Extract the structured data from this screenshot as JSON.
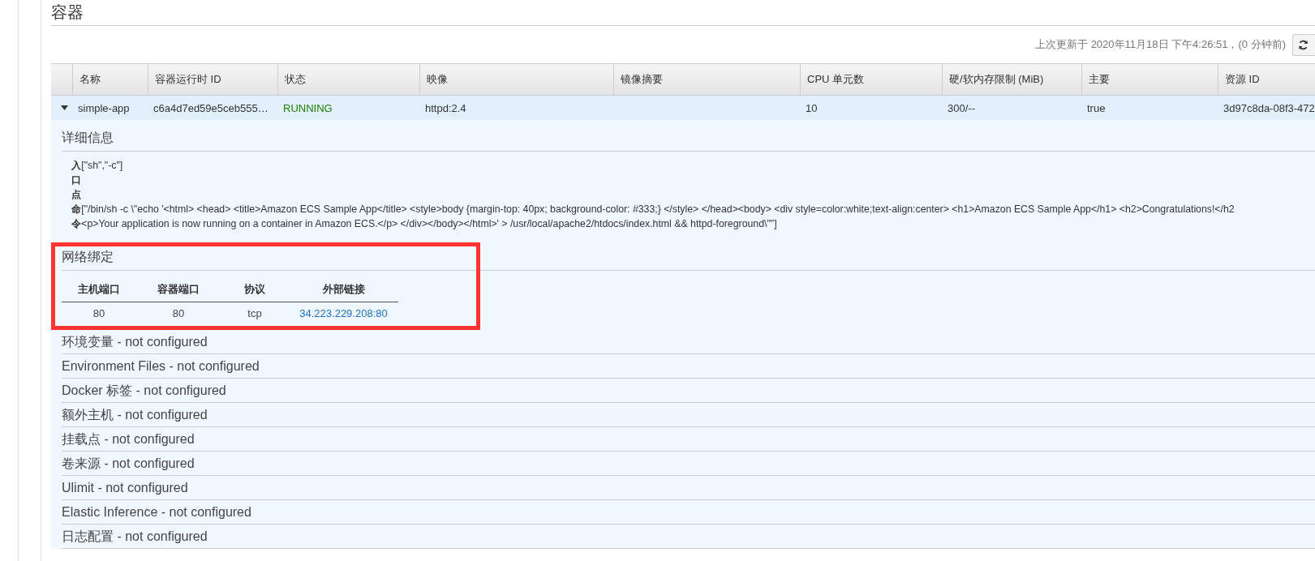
{
  "title": "容器",
  "last_updated": "上次更新于 2020年11月18日 下午4:26:51，(0 分钟前)",
  "table": {
    "columns": [
      "名称",
      "容器运行时 ID",
      "状态",
      "映像",
      "镜像摘要",
      "CPU 单元数",
      "硬/软内存限制 (MiB)",
      "主要",
      "资源 ID"
    ],
    "rows": [
      {
        "expanded": true,
        "cells": [
          "simple-app",
          "c6a4d7ed59e5ceb555…",
          "RUNNING",
          "httpd:2.4",
          "",
          "10",
          "300/--",
          "true",
          "3d97c8da-08f3-472"
        ]
      }
    ]
  },
  "details": {
    "title": "详细信息",
    "fields": [
      {
        "label": "入口点",
        "lines": [
          "[\"sh\",\"-c\"]"
        ]
      },
      {
        "label": "命令",
        "lines": [
          "[\"/bin/sh -c \\\"echo '<html> <head> <title>Amazon ECS Sample App</title> <style>body {margin-top: 40px; background-color: #333;} </style> </head><body> <div style=color:white;text-align:center> <h1>Amazon ECS Sample App</h1> <h2>Congratulations!</h2",
          "<p>Your application is now running on a container in Amazon ECS.</p> </div></body></html>' > /usr/local/apache2/htdocs/index.html && httpd-foreground\\\"\"]"
        ]
      }
    ]
  },
  "network": {
    "title": "网络绑定",
    "columns": [
      "主机端口",
      "容器端口",
      "协议",
      "外部链接"
    ],
    "rows": [
      [
        "80",
        "80",
        "tcp",
        "34.223.229.208:80"
      ]
    ]
  },
  "sections": [
    "环境变量 - not configured",
    "Environment Files - not configured",
    "Docker 标签 - not configured",
    "额外主机 - not configured",
    "挂载点 - not configured",
    "卷来源 - not configured",
    "Ulimit - not configured",
    "Elastic Inference - not configured",
    "日志配置 - not configured"
  ]
}
